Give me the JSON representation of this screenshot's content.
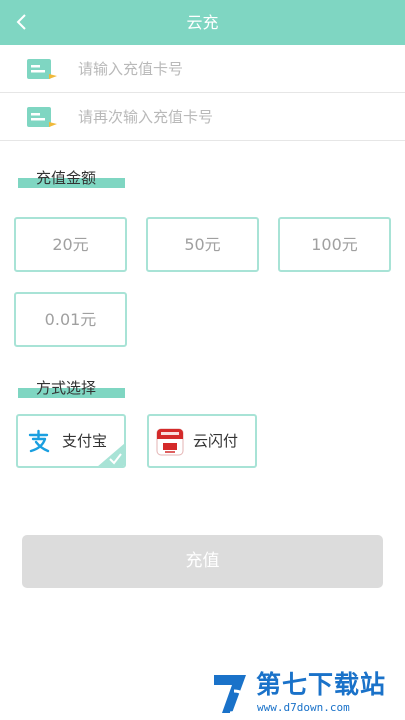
{
  "header": {
    "title": "云充"
  },
  "inputs": {
    "card_number_placeholder": "请输入充值卡号",
    "card_number_confirm_placeholder": "请再次输入充值卡号"
  },
  "amount_section": {
    "label": "充值金额",
    "options": [
      "20元",
      "50元",
      "100元",
      "0.01元"
    ]
  },
  "payment_section": {
    "label": "方式选择",
    "methods": [
      {
        "label": "支付宝",
        "icon": "alipay-icon",
        "selected": true
      },
      {
        "label": "云闪付",
        "icon": "unionpay-quickpass-icon",
        "selected": false
      }
    ]
  },
  "submit": {
    "label": "充值",
    "enabled": false
  },
  "watermark": {
    "title": "第七下载站",
    "url": "www.d7down.com"
  },
  "colors": {
    "accent": "#7fd6c2",
    "border": "#a8e3d6",
    "alipay_blue": "#1a9fe0",
    "union_red": "#d42a2a",
    "disabled_button": "#dcdcdc",
    "watermark_blue": "#1a72c9"
  }
}
